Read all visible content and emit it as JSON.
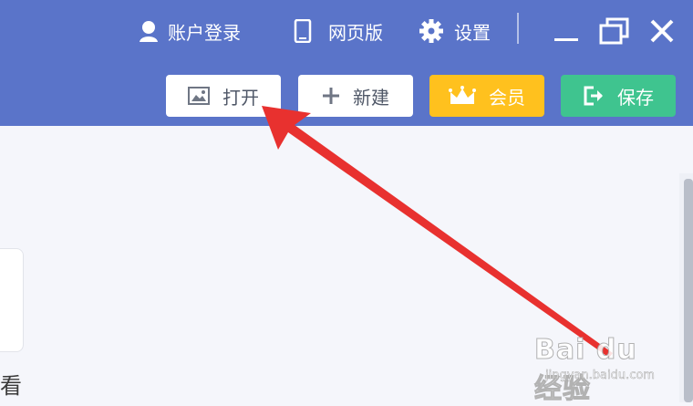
{
  "topbar": {
    "account_label": "账户登录",
    "web_label": "网页版",
    "settings_label": "设置"
  },
  "toolbar": {
    "open_label": "打开",
    "new_label": "新建",
    "vip_label": "会员",
    "save_label": "保存"
  },
  "content": {
    "partial_text": "看"
  },
  "colors": {
    "header": "#5a74c9",
    "vip": "#ffc11e",
    "save": "#3fc48f",
    "arrow": "#e8312f"
  },
  "watermark": {
    "logo": "Bai du 经验",
    "sub": "jingyan.baidu.com"
  }
}
